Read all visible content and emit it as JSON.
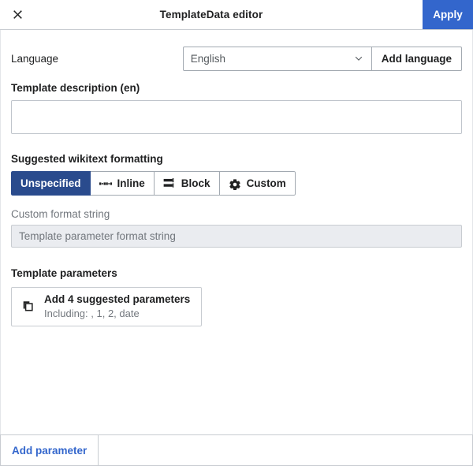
{
  "titlebar": {
    "close_icon": "close-icon",
    "title": "TemplateData editor",
    "apply_label": "Apply"
  },
  "language_row": {
    "label": "Language",
    "selected_language": "English",
    "dropdown_icon": "chevron-down-icon",
    "add_language_label": "Add language"
  },
  "description": {
    "heading": "Template description (en)",
    "value": "",
    "placeholder": ""
  },
  "formatting": {
    "heading": "Suggested wikitext formatting",
    "options": [
      {
        "label": "Unspecified",
        "icon": "",
        "selected": true
      },
      {
        "label": "Inline",
        "icon": "inline-icon",
        "selected": false
      },
      {
        "label": "Block",
        "icon": "block-icon",
        "selected": false
      },
      {
        "label": "Custom",
        "icon": "gear-icon",
        "selected": false
      }
    ],
    "custom_format_label": "Custom format string",
    "custom_format_value": "",
    "custom_format_placeholder": "Template parameter format string"
  },
  "parameters": {
    "heading": "Template parameters",
    "suggest_icon": "duplicate-icon",
    "suggest_title": "Add 4 suggested parameters",
    "suggest_subtitle": "Including: , 1, 2, date"
  },
  "footer": {
    "add_parameter_label": "Add parameter"
  },
  "colors": {
    "accent_blue": "#3366cc",
    "selected_blue": "#2a4b8d",
    "border_gray": "#a2a9b1",
    "light_border": "#c8ccd1",
    "disabled_bg": "#eaecf0",
    "muted_text": "#72777d",
    "text": "#202122"
  }
}
